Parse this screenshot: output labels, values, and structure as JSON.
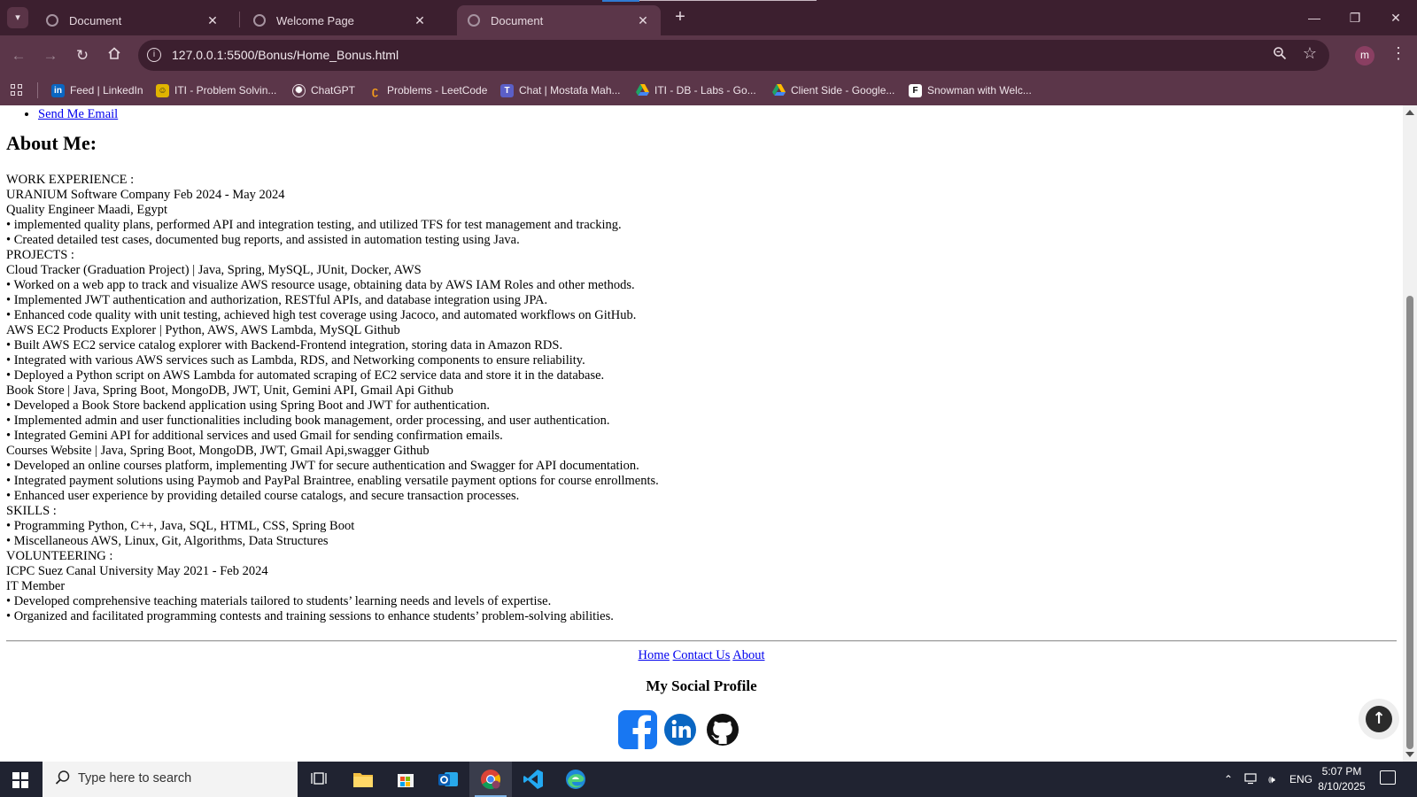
{
  "browser": {
    "tabs": [
      {
        "title": "Document",
        "active": false
      },
      {
        "title": "Welcome Page",
        "active": false
      },
      {
        "title": "Document",
        "active": true
      }
    ],
    "url": "127.0.0.1:5500/Bonus/Home_Bonus.html",
    "profile_initial": "m",
    "bookmarks": [
      {
        "label": "Feed | LinkedIn",
        "icon": "linkedin-icon",
        "color": "#0a66c2"
      },
      {
        "label": "ITI - Problem Solvin...",
        "icon": "iti-icon",
        "color": "#e0b400"
      },
      {
        "label": "ChatGPT",
        "icon": "chatgpt-icon",
        "color": "#5b3649"
      },
      {
        "label": "Problems - LeetCode",
        "icon": "leetcode-icon",
        "color": "#f89f1b"
      },
      {
        "label": "Chat | Mostafa Mah...",
        "icon": "teams-icon",
        "color": "#5b5fc7"
      },
      {
        "label": "ITI - DB - Labs - Go...",
        "icon": "google-drive-icon",
        "color": "#1fa463"
      },
      {
        "label": "Client Side - Google...",
        "icon": "google-drive-icon",
        "color": "#1fa463"
      },
      {
        "label": "Snowman with Welc...",
        "icon": "figma-icon",
        "color": "#000000"
      }
    ]
  },
  "page": {
    "top_link": "Send Me Email",
    "about_title": "About Me:",
    "resume_lines": [
      "WORK EXPERIENCE :",
      "URANIUM Software Company Feb 2024 - May 2024",
      "Quality Engineer Maadi, Egypt",
      "• implemented quality plans, performed API and integration testing, and utilized TFS for test management and tracking.",
      "• Created detailed test cases, documented bug reports, and assisted in automation testing using Java.",
      "PROJECTS :",
      "Cloud Tracker (Graduation Project) | Java, Spring, MySQL, JUnit, Docker, AWS",
      "• Worked on a web app to track and visualize AWS resource usage, obtaining data by AWS IAM Roles and other methods.",
      "• Implemented JWT authentication and authorization, RESTful APIs, and database integration using JPA.",
      "• Enhanced code quality with unit testing, achieved high test coverage using Jacoco, and automated workflows on GitHub.",
      "AWS EC2 Products Explorer | Python, AWS, AWS Lambda, MySQL Github",
      "• Built AWS EC2 service catalog explorer with Backend-Frontend integration, storing data in Amazon RDS.",
      "• Integrated with various AWS services such as Lambda, RDS, and Networking components to ensure reliability.",
      "• Deployed a Python script on AWS Lambda for automated scraping of EC2 service data and store it in the database.",
      "Book Store | Java, Spring Boot, MongoDB, JWT, Unit, Gemini API, Gmail Api Github",
      "• Developed a Book Store backend application using Spring Boot and JWT for authentication.",
      "• Implemented admin and user functionalities including book management, order processing, and user authentication.",
      "• Integrated Gemini API for additional services and used Gmail for sending confirmation emails.",
      "Courses Website | Java, Spring Boot, MongoDB, JWT, Gmail Api,swagger Github",
      "• Developed an online courses platform, implementing JWT for secure authentication and Swagger for API documentation.",
      "• Integrated payment solutions using Paymob and PayPal Braintree, enabling versatile payment options for course enrollments.",
      "• Enhanced user experience by providing detailed course catalogs, and secure transaction processes.",
      "SKILLS :",
      "• Programming Python, C++, Java, SQL, HTML, CSS, Spring Boot",
      "• Miscellaneous AWS, Linux, Git, Algorithms, Data Structures",
      "VOLUNTEERING :",
      "ICPC Suez Canal University May 2021 - Feb 2024",
      "IT Member",
      "• Developed comprehensive teaching materials tailored to students’ learning needs and levels of expertise.",
      "• Organized and facilitated programming contests and training sessions to enhance students’ problem-solving abilities."
    ],
    "footer_links": [
      "Home",
      "Contact Us",
      "About"
    ],
    "social_title": "My Social Profile",
    "socials": [
      {
        "name": "facebook-icon",
        "color": "#1877f2"
      },
      {
        "name": "linkedin-icon",
        "color": "#0a66c2"
      },
      {
        "name": "github-icon",
        "color": "#111111"
      }
    ]
  },
  "taskbar": {
    "search_placeholder": "Type here to search",
    "language": "ENG",
    "time": "5:07 PM",
    "date": "8/10/2025"
  }
}
